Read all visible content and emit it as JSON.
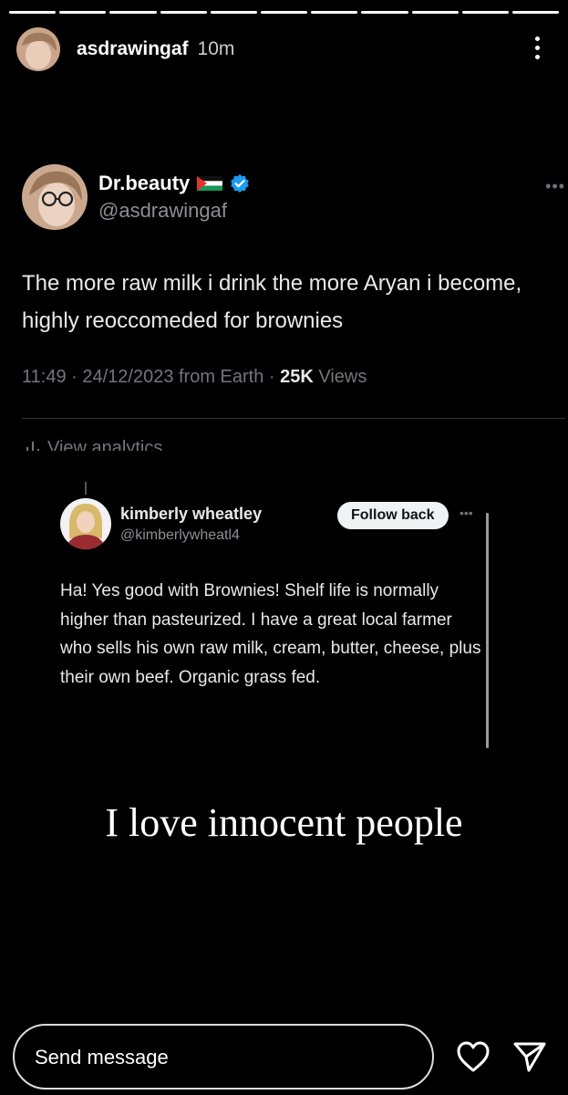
{
  "story": {
    "username": "asdrawingaf",
    "time_ago": "10m",
    "segments": 11
  },
  "tweet": {
    "display_name": "Dr.beauty",
    "flag": "palestine-flag-icon",
    "verified": "verified-badge-icon",
    "handle": "@asdrawingaf",
    "text": "The more raw milk i drink the more Aryan i become, highly reoccomeded for brownies",
    "meta_prefix": "11:49 · 24/12/2023 from Earth · ",
    "views_count": "25K",
    "views_label": " Views",
    "analytics_label": "View analytics"
  },
  "reply": {
    "display_name": "kimberly wheatley",
    "handle": "@kimberlywheatl4",
    "follow_label": "Follow back",
    "text": "Ha! Yes good with Brownies! Shelf life is normally higher than pasteurized.  I have a great local farmer who sells his own raw milk, cream, butter, cheese, plus their own beef. Organic grass fed."
  },
  "caption": "I love innocent people",
  "footer": {
    "message_placeholder": "Send message"
  },
  "colors": {
    "background": "#000000",
    "verified": "#1d9bf0",
    "muted_text": "#71767b"
  }
}
